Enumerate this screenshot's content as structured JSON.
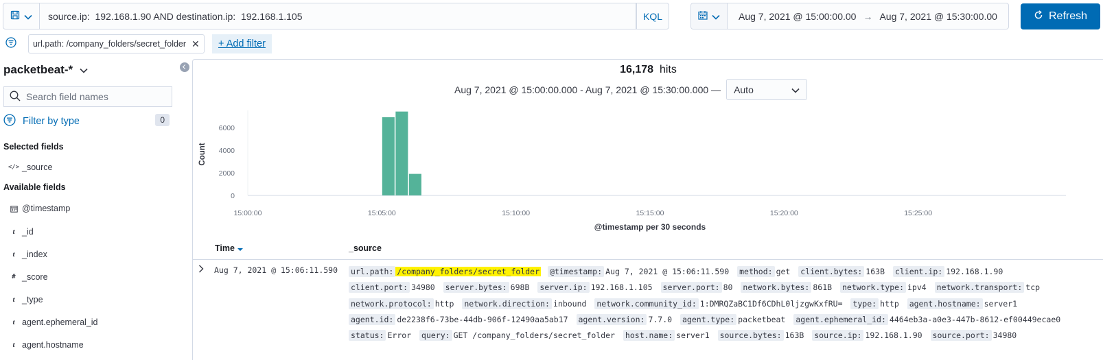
{
  "query_bar": {
    "query": "source.ip:  192.168.1.90 AND destination.ip:  192.168.1.105",
    "language": "KQL",
    "time_from": "Aug 7, 2021 @ 15:00:00.00",
    "time_arrow": "→",
    "time_to": "Aug 7, 2021 @ 15:30:00.00",
    "refresh_label": "Refresh",
    "accent_color": "#006bb4"
  },
  "filters": {
    "pill": "url.path: /company_folders/secret_folder",
    "add_filter_label": "+ Add filter"
  },
  "sidebar": {
    "index_pattern": "packetbeat-*",
    "search_placeholder": "Search field names",
    "filter_by_type": "Filter by type",
    "filter_count": "0",
    "selected_title": "Selected fields",
    "selected_fields": [
      {
        "type_icon": "</>",
        "name": "_source"
      }
    ],
    "available_title": "Available fields",
    "available_fields": [
      {
        "type_icon": "calendar-icon",
        "name": "@timestamp"
      },
      {
        "type_icon": "t",
        "name": "_id"
      },
      {
        "type_icon": "t",
        "name": "_index"
      },
      {
        "type_icon": "#",
        "name": "_score"
      },
      {
        "type_icon": "t",
        "name": "_type"
      },
      {
        "type_icon": "t",
        "name": "agent.ephemeral_id"
      },
      {
        "type_icon": "t",
        "name": "agent.hostname"
      }
    ]
  },
  "main": {
    "hits_count": "16,178",
    "hits_label": "hits",
    "range_text": "Aug 7, 2021 @ 15:00:00.000 - Aug 7, 2021 @ 15:30:00.000 —",
    "interval": "Auto"
  },
  "chart_data": {
    "type": "bar",
    "title": "",
    "xlabel": "@timestamp per 30 seconds",
    "ylabel": "Count",
    "x_ticks": [
      "15:00:00",
      "15:05:00",
      "15:10:00",
      "15:15:00",
      "15:20:00",
      "15:25:00"
    ],
    "y_ticks": [
      0,
      2000,
      4000,
      6000
    ],
    "ylim": [
      0,
      7500
    ],
    "x_range_seconds": [
      0,
      1800
    ],
    "bars": [
      {
        "x": "15:05:00",
        "value": 6900
      },
      {
        "x": "15:05:30",
        "value": 7400
      },
      {
        "x": "15:06:00",
        "value": 1900
      }
    ],
    "bar_color": "#54b399",
    "grid": false
  },
  "table": {
    "col_time": "Time",
    "col_source": "_source",
    "rows": [
      {
        "time": "Aug 7, 2021 @ 15:06:11.590",
        "fields": [
          {
            "k": "url.path:",
            "v": "/company_folders/secret_folder",
            "highlight": true
          },
          {
            "k": "@timestamp:",
            "v": "Aug 7, 2021 @ 15:06:11.590"
          },
          {
            "k": "method:",
            "v": "get"
          },
          {
            "k": "client.bytes:",
            "v": "163B"
          },
          {
            "k": "client.ip:",
            "v": "192.168.1.90"
          },
          {
            "k": "client.port:",
            "v": "34980"
          },
          {
            "k": "server.bytes:",
            "v": "698B"
          },
          {
            "k": "server.ip:",
            "v": "192.168.1.105"
          },
          {
            "k": "server.port:",
            "v": "80"
          },
          {
            "k": "network.bytes:",
            "v": "861B"
          },
          {
            "k": "network.type:",
            "v": "ipv4"
          },
          {
            "k": "network.transport:",
            "v": "tcp"
          },
          {
            "k": "network.protocol:",
            "v": "http"
          },
          {
            "k": "network.direction:",
            "v": "inbound"
          },
          {
            "k": "network.community_id:",
            "v": "1:DMRQZaBC1Df6CDhL0ljzgwKxfRU="
          },
          {
            "k": "type:",
            "v": "http"
          },
          {
            "k": "agent.hostname:",
            "v": "server1"
          },
          {
            "k": "agent.id:",
            "v": "de2238f6-73be-44db-906f-12490aa5ab17"
          },
          {
            "k": "agent.version:",
            "v": "7.7.0"
          },
          {
            "k": "agent.type:",
            "v": "packetbeat"
          },
          {
            "k": "agent.ephemeral_id:",
            "v": "4464eb3a-a0e3-447b-8612-ef00449ecae0"
          },
          {
            "k": "status:",
            "v": "Error"
          },
          {
            "k": "query:",
            "v": "GET /company_folders/secret_folder"
          },
          {
            "k": "host.name:",
            "v": "server1"
          },
          {
            "k": "source.bytes:",
            "v": "163B"
          },
          {
            "k": "source.ip:",
            "v": "192.168.1.90"
          },
          {
            "k": "source.port:",
            "v": "34980"
          }
        ]
      }
    ]
  }
}
